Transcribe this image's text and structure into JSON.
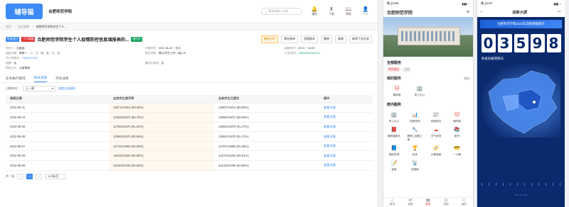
{
  "desktop": {
    "logo_text": "辅导猫",
    "org_name": "合肥师范学院",
    "search_placeholder": "搜索或输入功能",
    "tools": [
      {
        "icon": "bell-icon",
        "glyph": "🔔",
        "label": "通知"
      },
      {
        "icon": "download-icon",
        "glyph": "⬇",
        "label": "下载"
      },
      {
        "icon": "book-icon",
        "glyph": "📖",
        "label": "帮助"
      },
      {
        "icon": "user-icon",
        "glyph": "👤",
        "label": "个人"
      }
    ],
    "breadcrumb": [
      "首页",
      "活动管理",
      "合肥师范学院学生个人..."
    ],
    "tags": [
      {
        "text": "任务进行",
        "color": "#3d8bf6"
      },
      {
        "text": "个人填报",
        "color": "#e23b3b"
      }
    ],
    "page_title": "合肥师范学院学生个人疫情防控信息填报表的...",
    "title_badge": "进行中",
    "actions": [
      "数据分析",
      "预览表单",
      "创建副本",
      "删除",
      "复制",
      "继续下次任务"
    ],
    "info": [
      {
        "k": "发布人：",
        "v": "后勤部"
      },
      {
        "k": "开始时间：",
        "v": "2022-06-19 ~ 长久"
      },
      {
        "k": "填报时间：",
        "v": "00:01 ~ 14:00"
      },
      {
        "k": "填报对象：",
        "v": "每周一、二、三、四、五、六、日"
      },
      {
        "k": "提交次数：",
        "v": "每日/学生工作（填1-5）"
      },
      {
        "k": "已交/应交：",
        "v": "15806/48 96.67%"
      },
      {
        "k": "今日完成率：",
        "v": "7948 83.32%"
      },
      {
        "k": "",
        "v": ""
      },
      {
        "k": "",
        "v": ""
      },
      {
        "k": "提醒：",
        "v": "否"
      },
      {
        "k": "撤回后修改：",
        "v": "否"
      },
      {
        "k": "",
        "v": ""
      },
      {
        "k": "审核方式：",
        "v": "无需审核"
      }
    ],
    "tabs": [
      "任务执行情况",
      "每日详情",
      "学生详情"
    ],
    "active_tab": 1,
    "filter_label": "日期时间：",
    "filter_value": "上一周",
    "filter_link": "查看全部填报",
    "columns": [
      "填报日期",
      "全校学生填写率",
      "全校学生已提交",
      "操作"
    ],
    "rows": [
      {
        "date": "2022-06-11",
        "rate": "12571/14913 (89.28%)",
        "done": "12697/14913 (88.60%)",
        "op": "查看详情"
      },
      {
        "date": "2022-06-10",
        "rate": "12484/14872 (88.79%)",
        "done": "12558/14872 (88.30%)",
        "op": "查看详情"
      },
      {
        "date": "2022-06-09",
        "rate": "12794/14875 (91.62%)",
        "done": "12662/14875 (91.27%)",
        "op": "查看详情"
      },
      {
        "date": "2022-06-08",
        "rate": "12968/14875 (90.99%)",
        "done": "12662/14875 (91.27%)",
        "op": "查看详情"
      },
      {
        "date": "2022-06-07",
        "rate": "12718/13993 (90.89%)",
        "done": "12787/13993 (91.38%)",
        "op": "查看详情"
      },
      {
        "date": "2022-06-06",
        "rate": "12643/13294 (90.58%)",
        "done": "12572/13294 (90.61%)",
        "op": "查看详情"
      },
      {
        "date": "2022-06-05",
        "rate": "10180/10795 (94.60%)",
        "done": "10210/10795 (94.58%)",
        "op": "查看详情"
      }
    ],
    "pager": {
      "total": "共 7 条",
      "current": "1",
      "size": "10 条/页"
    }
  },
  "phone1": {
    "time": "晚上9:56",
    "title": "合肥师范学院",
    "all_services": "全部服务",
    "chips": [
      "常用服务",
      "全部"
    ],
    "my_services": "我的服务",
    "edit": "编辑",
    "my_items": [
      {
        "icon": "cat-icon",
        "glyph": "🐱",
        "label": "辅导猫"
      },
      {
        "icon": "office-icon",
        "glyph": "🏢",
        "label": "掌上办公"
      }
    ],
    "campus_services": "校内服务",
    "campus_items": [
      {
        "icon": "office-icon",
        "glyph": "🏢",
        "label": "掌上办公"
      },
      {
        "icon": "score-icon",
        "glyph": "📊",
        "label": "成绩查询"
      },
      {
        "icon": "news-icon",
        "glyph": "📰",
        "label": "校园资讯"
      },
      {
        "icon": "cat-icon",
        "glyph": "🐱",
        "label": "辅导猫"
      },
      {
        "icon": "handbook-icon",
        "glyph": "📕",
        "label": "辅导猫助手"
      },
      {
        "icon": "repair-icon",
        "glyph": "🔧",
        "label": "教职工疫情上报"
      },
      {
        "icon": "weather-icon",
        "glyph": "☁",
        "label": "天气查询"
      },
      {
        "icon": "book-icon",
        "glyph": "📚",
        "label": "图书"
      },
      {
        "icon": "library-icon",
        "glyph": "📘",
        "label": "借阅查询"
      },
      {
        "icon": "exam-icon",
        "glyph": "🏆",
        "label": "校考"
      },
      {
        "icon": "guide-icon",
        "glyph": "🧭",
        "label": "办事指南"
      },
      {
        "icon": "card-icon",
        "glyph": "💳",
        "label": "一卡通"
      },
      {
        "icon": "reg-icon",
        "glyph": "📝",
        "label": "迎新"
      },
      {
        "icon": "net-icon",
        "glyph": "📡",
        "label": "校园网"
      }
    ],
    "tabbar": [
      {
        "icon": "home-icon",
        "glyph": "⌂",
        "label": "首页"
      },
      {
        "icon": "message-icon",
        "glyph": "✉",
        "label": "消息"
      },
      {
        "icon": "service-icon",
        "glyph": "▦",
        "label": "服务"
      },
      {
        "icon": "discover-icon",
        "glyph": "◎",
        "label": "发现"
      },
      {
        "icon": "me-icon",
        "glyph": "☺",
        "label": "我的"
      }
    ]
  },
  "phone2": {
    "time": "晚上9:57",
    "title": "迎新大屏",
    "banner": "合肥师范学院2022年迎新数据统计",
    "digits": [
      "0",
      "3",
      "5",
      "9",
      "8"
    ],
    "subtitle": "各省份报到情况"
  }
}
